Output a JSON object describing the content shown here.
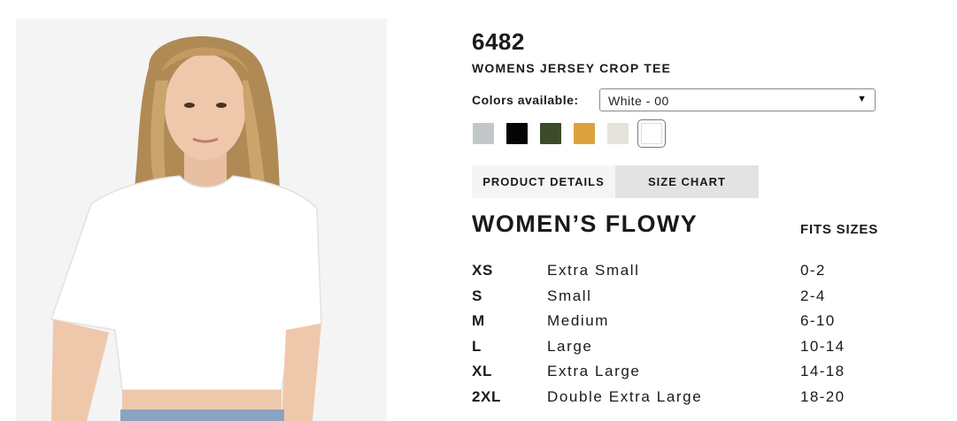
{
  "product": {
    "sku": "6482",
    "name": "WOMENS JERSEY CROP TEE",
    "colors_label": "Colors available:",
    "color_select": {
      "value": "White - 00"
    },
    "swatches": [
      {
        "color": "#c2c8ca",
        "name": "gray-swatch"
      },
      {
        "color": "#050505",
        "name": "black-swatch"
      },
      {
        "color": "#3d4a2c",
        "name": "olive-swatch"
      },
      {
        "color": "#dca33c",
        "name": "mustard-swatch"
      },
      {
        "color": "#e6e3dd",
        "name": "cream-swatch"
      },
      {
        "color": "#ffffff",
        "name": "white-swatch",
        "selected": true
      }
    ]
  },
  "tabs": {
    "details": "PRODUCT DETAILS",
    "size_chart": "SIZE CHART",
    "active": "size_chart"
  },
  "size_chart": {
    "title": "WOMEN’S FLOWY",
    "fits_header": "FITS SIZES",
    "rows": [
      {
        "abbr": "XS",
        "full": "Extra Small",
        "fits": "0-2"
      },
      {
        "abbr": "S",
        "full": "Small",
        "fits": "2-4"
      },
      {
        "abbr": "M",
        "full": "Medium",
        "fits": "6-10"
      },
      {
        "abbr": "L",
        "full": "Large",
        "fits": "10-14"
      },
      {
        "abbr": "XL",
        "full": "Extra Large",
        "fits": "14-18"
      },
      {
        "abbr": "2XL",
        "full": "Double Extra Large",
        "fits": "18-20"
      }
    ]
  }
}
